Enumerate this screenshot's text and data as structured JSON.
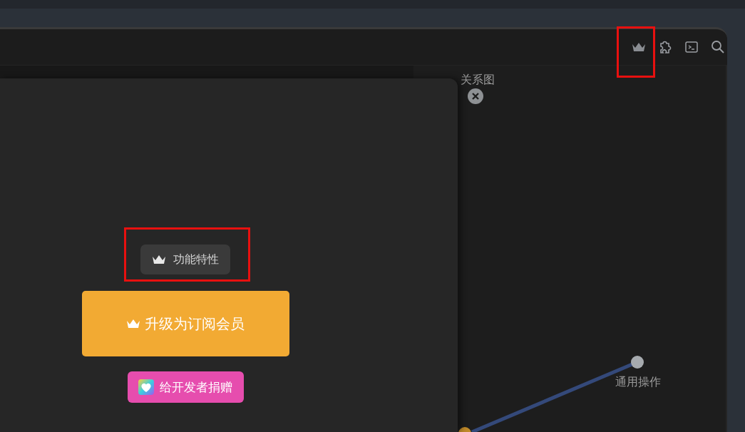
{
  "graph": {
    "title": "关系图",
    "nodes": [
      {
        "label": "通用操作"
      }
    ]
  },
  "dialog": {
    "features_button": "功能特性",
    "upgrade_button": "升级为订阅会员",
    "donate_button": "给开发者捐赠"
  }
}
